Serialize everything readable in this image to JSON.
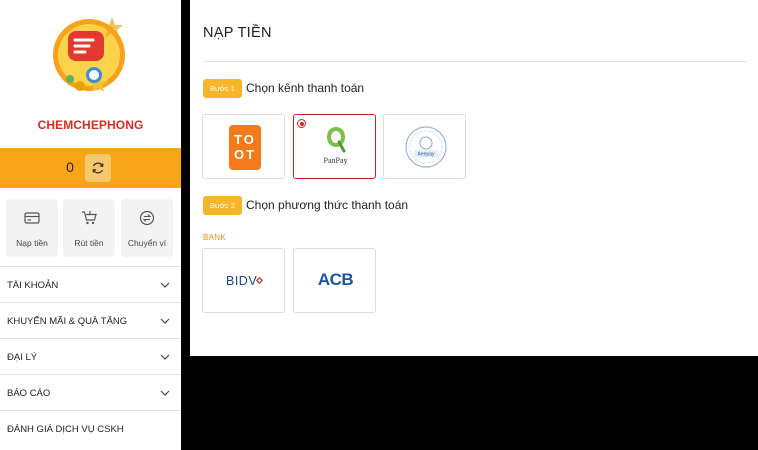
{
  "user": {
    "name": "CHEMCHEPHONG",
    "balance": "0"
  },
  "quick_actions": [
    {
      "label": "Nạp tiền",
      "icon": "card-icon"
    },
    {
      "label": "Rút tiền",
      "icon": "cart-icon"
    },
    {
      "label": "Chuyển ví",
      "icon": "transfer-icon"
    }
  ],
  "menu": [
    {
      "label": "TÀI KHOẢN",
      "has_chevron": true
    },
    {
      "label": "KHUYẾN MÃI & QUÀ TẶNG",
      "has_chevron": true
    },
    {
      "label": "ĐẠI LÝ",
      "has_chevron": true
    },
    {
      "label": "BÁO CÁO",
      "has_chevron": true
    },
    {
      "label": "ĐÁNH GIÁ DỊCH VỤ CSKH",
      "has_chevron": false
    }
  ],
  "page": {
    "title": "NẠP TIỀN",
    "step1": {
      "badge": "Bước 1",
      "text": "Chọn kênh thanh toán"
    },
    "step2": {
      "badge": "Bước 2",
      "text": "Chọn phương thức thanh toán"
    },
    "bank_label": "BANK"
  },
  "channels": [
    {
      "name": "TOOT",
      "logo_text": "TO OT",
      "selected": false
    },
    {
      "name": "PanPay",
      "logo_text": "PanPay",
      "selected": true
    },
    {
      "name": "Aeepay",
      "logo_text": "Aeepay",
      "selected": false
    }
  ],
  "banks": [
    {
      "name": "BIDV",
      "logo_text": "BIDV"
    },
    {
      "name": "ACB",
      "logo_text": "ACB"
    }
  ],
  "colors": {
    "accent_orange": "#f7a418",
    "brand_red": "#e0281e",
    "step_badge": "#f7b52a",
    "selected_border": "#c8201a"
  }
}
